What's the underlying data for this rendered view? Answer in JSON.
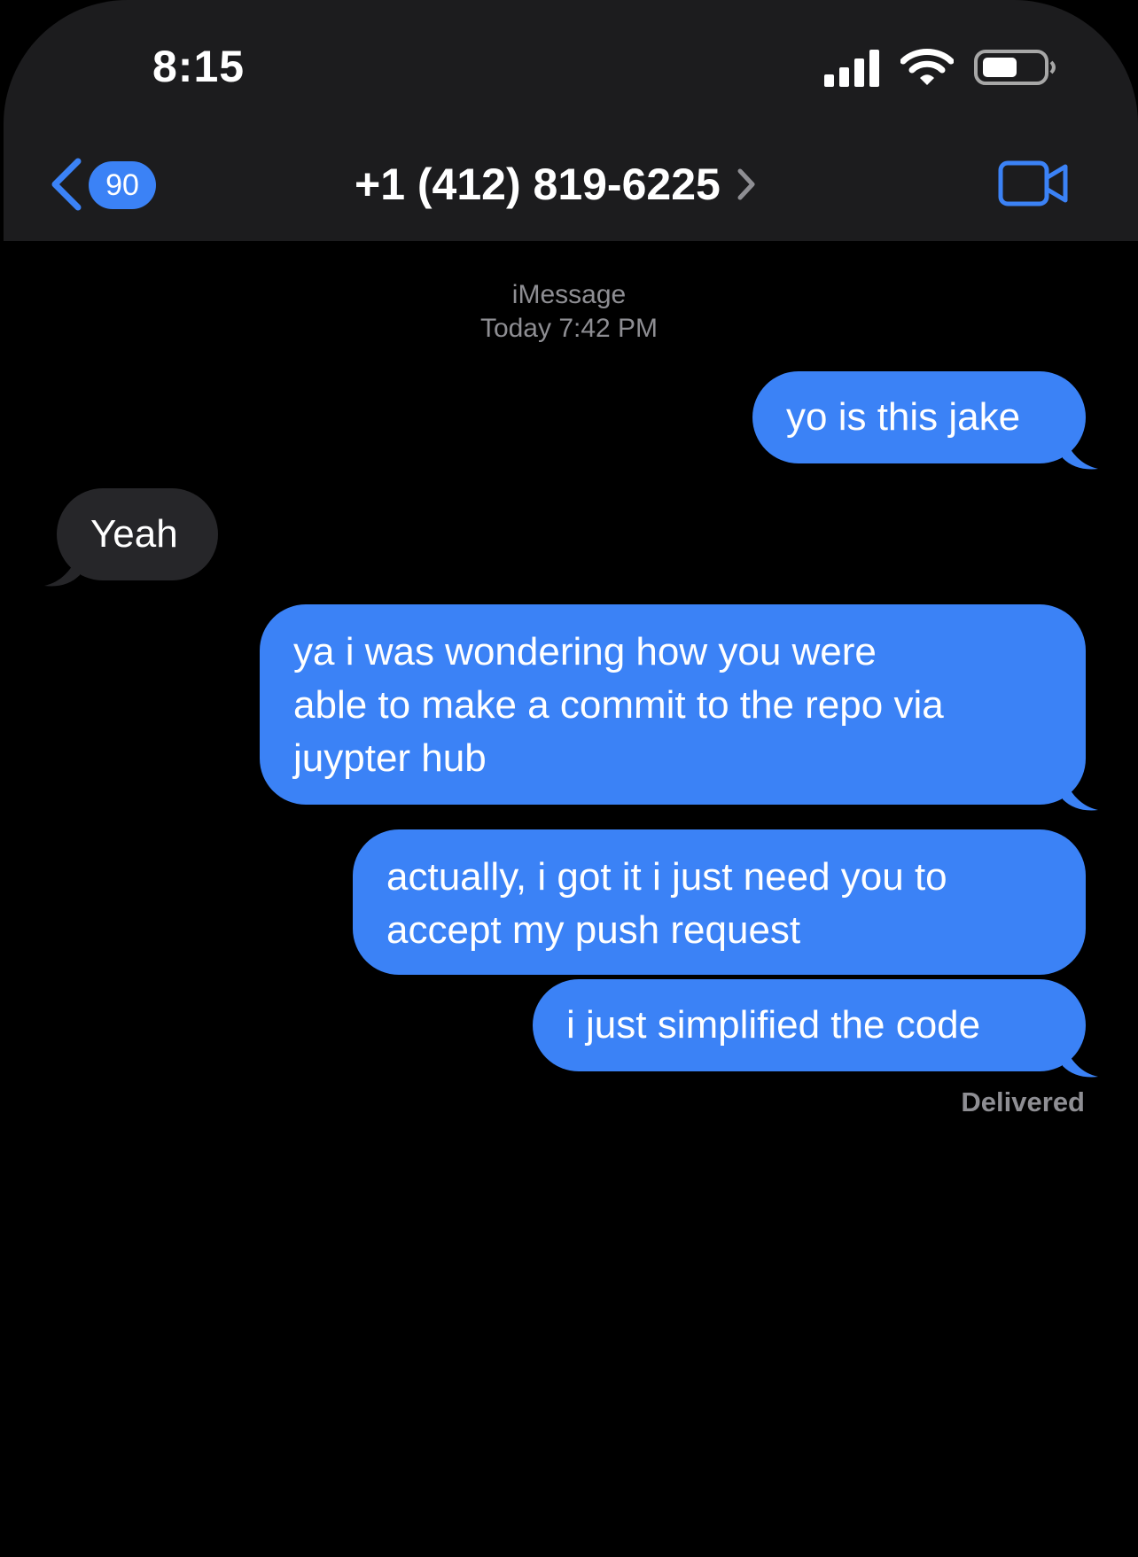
{
  "status_bar": {
    "time": "8:15",
    "icons": [
      "signal-icon",
      "wifi-icon",
      "battery-icon"
    ]
  },
  "nav": {
    "back_badge": "90",
    "contact": "+1 (412) 819-6225",
    "icons": [
      "back-chevron-icon",
      "chevron-right-icon",
      "video-call-icon"
    ]
  },
  "thread": {
    "service": "iMessage",
    "timestamp": "Today 7:42 PM",
    "messages": [
      {
        "direction": "out",
        "text": "yo is this jake"
      },
      {
        "direction": "in",
        "text": "Yeah"
      },
      {
        "direction": "out",
        "text": "ya i was wondering how you were\nable to make a commit to the repo via\njuypter hub"
      },
      {
        "direction": "out",
        "text": "actually, i got it i just need you to\naccept my push request"
      },
      {
        "direction": "out",
        "text": "i just simplified the code"
      }
    ],
    "status": "Delivered"
  },
  "colors": {
    "outgoing": "#3b82f6",
    "incoming": "#262629",
    "header_bg": "#1c1c1e",
    "accent": "#3b82f6",
    "muted_text": "#8e8e93"
  }
}
